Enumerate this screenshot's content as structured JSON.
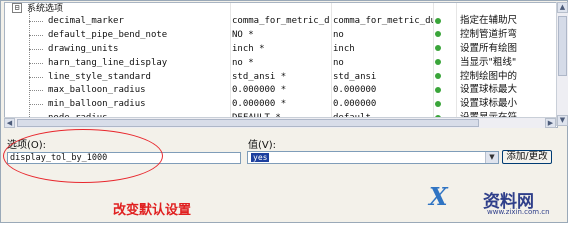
{
  "table": {
    "expander_symbol": "⊟",
    "group_label": "系统选项",
    "rows": [
      {
        "name": "decimal_marker",
        "current": "comma_for_metric_d...",
        "default": "comma_for_metric_dual",
        "desc": "指定在辅助尺"
      },
      {
        "name": "default_pipe_bend_note",
        "current": "NO *",
        "default": "no",
        "desc": "控制管道折弯"
      },
      {
        "name": "drawing_units",
        "current": "inch *",
        "default": "inch",
        "desc": "设置所有绘图"
      },
      {
        "name": "harn_tang_line_display",
        "current": "no *",
        "default": "no",
        "desc": "当显示\"粗线\""
      },
      {
        "name": "line_style_standard",
        "current": "std_ansi *",
        "default": "std_ansi",
        "desc": "控制绘图中的"
      },
      {
        "name": "max_balloon_radius",
        "current": "0.000000 *",
        "default": "0.000000",
        "desc": "设置球标最大"
      },
      {
        "name": "min_balloon_radius",
        "current": "0.000000 *",
        "default": "0.000000",
        "desc": "设置球标最小"
      },
      {
        "name": "node_radius",
        "current": "DEFAULT *",
        "default": "default",
        "desc": "设置显示在符"
      }
    ],
    "status_color": "#3aa53a"
  },
  "form": {
    "option_label": "选项(O):",
    "option_value": "display_tol_by_1000",
    "value_label": "值(V):",
    "value_selected": "yes",
    "add_change_button": "添加/更改"
  },
  "annotation": {
    "caption": "改变默认设置",
    "highlight_color": "#e8282e"
  },
  "watermark": {
    "logo_text": "X",
    "title": "资料网",
    "url": "www.zixin.com.cn"
  }
}
